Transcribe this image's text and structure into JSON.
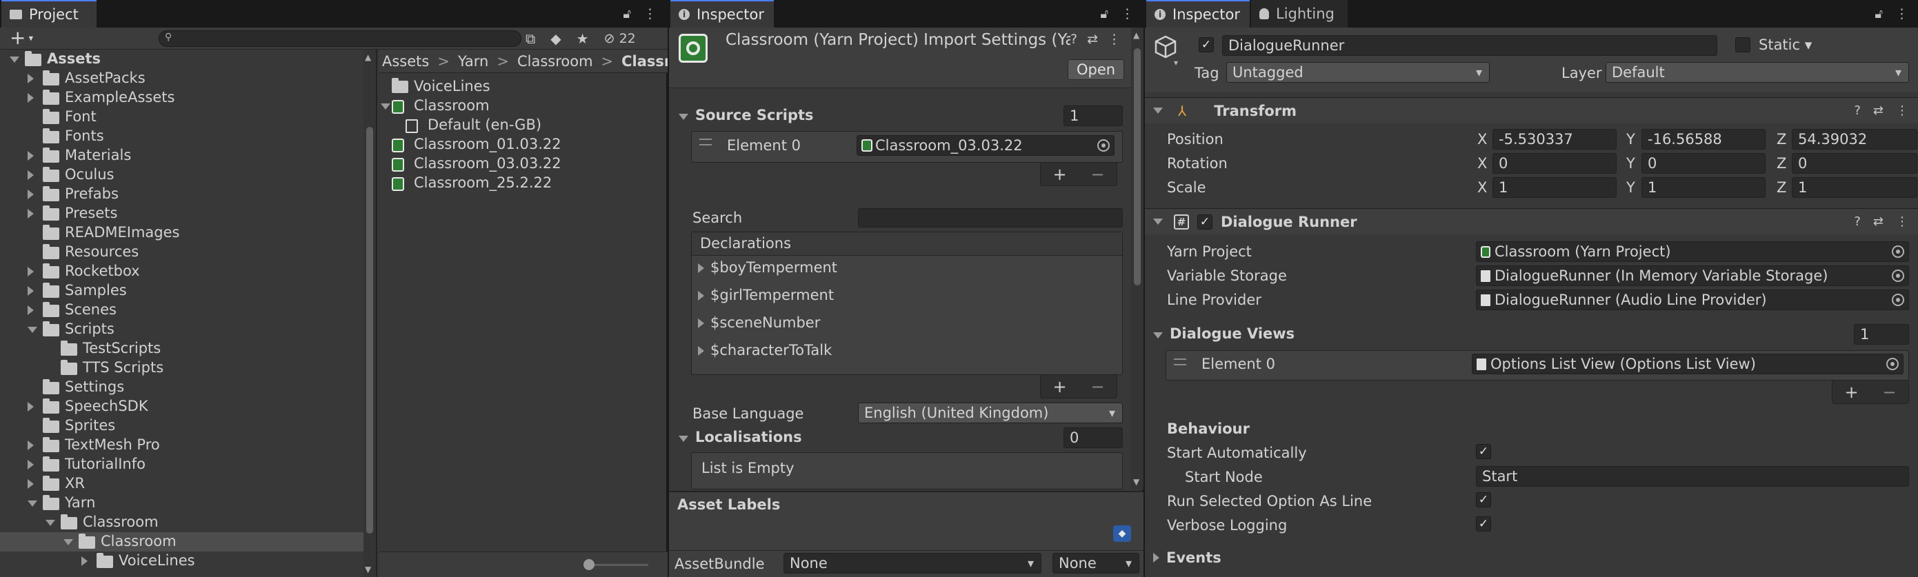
{
  "project": {
    "tab_label": "Project",
    "search_placeholder": "",
    "hidden_count": "22",
    "tree": [
      {
        "label": "Assets",
        "arrow": "down",
        "bold": true
      },
      {
        "label": "AssetPacks",
        "arrow": "right"
      },
      {
        "label": "ExampleAssets",
        "arrow": "right"
      },
      {
        "label": "Font",
        "arrow": "none"
      },
      {
        "label": "Fonts",
        "arrow": "none"
      },
      {
        "label": "Materials",
        "arrow": "right"
      },
      {
        "label": "Oculus",
        "arrow": "right"
      },
      {
        "label": "Prefabs",
        "arrow": "right"
      },
      {
        "label": "Presets",
        "arrow": "right"
      },
      {
        "label": "READMEImages",
        "arrow": "none"
      },
      {
        "label": "Resources",
        "arrow": "none"
      },
      {
        "label": "Rocketbox",
        "arrow": "right"
      },
      {
        "label": "Samples",
        "arrow": "right"
      },
      {
        "label": "Scenes",
        "arrow": "right"
      },
      {
        "label": "Scripts",
        "arrow": "down"
      },
      {
        "label": "TestScripts",
        "arrow": "none"
      },
      {
        "label": "TTS Scripts",
        "arrow": "none"
      },
      {
        "label": "Settings",
        "arrow": "none"
      },
      {
        "label": "SpeechSDK",
        "arrow": "right"
      },
      {
        "label": "Sprites",
        "arrow": "none"
      },
      {
        "label": "TextMesh Pro",
        "arrow": "right"
      },
      {
        "label": "TutorialInfo",
        "arrow": "right"
      },
      {
        "label": "XR",
        "arrow": "right"
      },
      {
        "label": "Yarn",
        "arrow": "down"
      },
      {
        "label": "Classroom",
        "arrow": "down"
      },
      {
        "label": "Classroom",
        "arrow": "down",
        "selected": true
      },
      {
        "label": "VoiceLines",
        "arrow": "right"
      }
    ],
    "breadcrumb": [
      "Assets",
      "Yarn",
      "Classroom",
      "Classroom"
    ],
    "files": [
      {
        "label": "VoiceLines",
        "icon": "folder"
      },
      {
        "label": "Classroom",
        "icon": "yarn-project",
        "arrow": "down"
      },
      {
        "label": "Default (en-GB)",
        "icon": "doc"
      },
      {
        "label": "Classroom_01.03.22",
        "icon": "yarn-script"
      },
      {
        "label": "Classroom_03.03.22",
        "icon": "yarn-script"
      },
      {
        "label": "Classroom_25.2.22",
        "icon": "yarn-script"
      }
    ]
  },
  "import": {
    "tab_label": "Inspector",
    "title": "Classroom (Yarn Project) Import Settings (Ya",
    "open_button": "Open",
    "source_scripts_label": "Source Scripts",
    "source_scripts_count": "1",
    "element0_label": "Element 0",
    "element0_value": "Classroom_03.03.22",
    "search_label": "Search",
    "search_value": "",
    "declarations_label": "Declarations",
    "declarations": [
      "$boyTemperment",
      "$girlTemperment",
      "$sceneNumber",
      "$characterToTalk"
    ],
    "base_language_label": "Base Language",
    "base_language_value": "English (United Kingdom)",
    "localisations_label": "Localisations",
    "localisations_count": "0",
    "list_empty": "List is Empty",
    "asset_labels": "Asset Labels",
    "assetbundle_label": "AssetBundle",
    "assetbundle_value": "None",
    "assetbundle_variant": "None"
  },
  "inspector": {
    "tab_label": "Inspector",
    "lighting_tab": "Lighting",
    "object_name": "DialogueRunner",
    "static_label": "Static",
    "tag_label": "Tag",
    "tag_value": "Untagged",
    "layer_label": "Layer",
    "layer_value": "Default",
    "transform_label": "Transform",
    "position_label": "Position",
    "rotation_label": "Rotation",
    "scale_label": "Scale",
    "axis_x": "X",
    "axis_y": "Y",
    "axis_z": "Z",
    "position": [
      "-5.530337",
      "-16.56588",
      "54.39032"
    ],
    "rotation": [
      "0",
      "0",
      "0"
    ],
    "scale": [
      "1",
      "1",
      "1"
    ],
    "component_label": "Dialogue Runner",
    "yarn_project_label": "Yarn Project",
    "yarn_project_value": "Classroom (Yarn Project)",
    "variable_storage_label": "Variable Storage",
    "variable_storage_value": "DialogueRunner (In Memory Variable Storage)",
    "line_provider_label": "Line Provider",
    "line_provider_value": "DialogueRunner (Audio Line Provider)",
    "dialogue_views_label": "Dialogue Views",
    "dialogue_views_count": "1",
    "element0_label": "Element 0",
    "element0_value": "Options List View (Options List View)",
    "behaviour_label": "Behaviour",
    "start_auto_label": "Start Automatically",
    "start_node_label": "Start Node",
    "start_node_value": "Start",
    "run_selected_label": "Run Selected Option As Line",
    "verbose_label": "Verbose Logging",
    "events_label": "Events"
  }
}
